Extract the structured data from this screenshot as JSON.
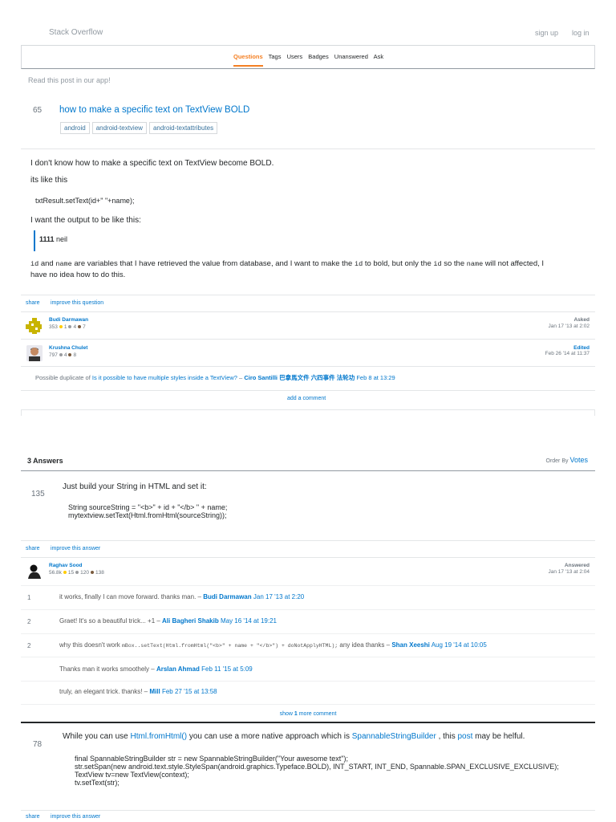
{
  "topbar": {
    "site": "Stack Overflow",
    "signup": "sign up",
    "login": "log in"
  },
  "nav": {
    "items": [
      "Questions",
      "Tags",
      "Users",
      "Badges",
      "Unanswered",
      "Ask"
    ],
    "active": "Questions"
  },
  "app_prompt": "Read this post in our app!",
  "question": {
    "votes": "65",
    "title": "how to make a specific text on TextView BOLD",
    "tags": [
      "android",
      "android-textview",
      "android-textattributes"
    ],
    "body1": "I don't know how to make a specific text on TextView become BOLD.",
    "body2": "its like this",
    "code": "txtResult.setText(id+\" \"+name);",
    "body3": "I want the output to be like this:",
    "quote_bold": "1111",
    "quote_rest": " neil",
    "body4_a": "id",
    "body4_b": " and ",
    "body4_c": "name",
    "body4_d": " are variables that I have retrieved the value from database, and I want to make the ",
    "body4_e": "id",
    "body4_f": " to bold, but only the ",
    "body4_g": "id",
    "body4_h": " so the ",
    "body4_i": "name",
    "body4_j": " will not affected, I",
    "body4_k": "have no idea how to do this.",
    "share": "share",
    "improve": "improve this question",
    "asker": {
      "name": "Budi Darmawan",
      "rep": "353",
      "gold": "1",
      "silver": "4",
      "bronze": "7",
      "action": "Asked",
      "date": "Jan 17 '13 at 2:02"
    },
    "editor": {
      "name": "Krushna Chulet",
      "rep": "797",
      "silver": "4",
      "bronze": "8",
      "action": "Edited",
      "date": "Feb 26 '14 at 11:37"
    },
    "comment": {
      "prefix": "Possible duplicate of ",
      "link": "Is it possible to have multiple styles inside a TextView?",
      "dash": " – ",
      "user": "Ciro Santilli 巴拿馬文件 六四事件 法轮功",
      "date": "Feb 8 at 13:29"
    },
    "add_comment": "add a comment"
  },
  "answers_header": {
    "count": "3 Answers",
    "order_label": "Order By",
    "order_value": "Votes"
  },
  "answer1": {
    "votes": "135",
    "text": "Just build your String in HTML and set it:",
    "code1": "String sourceString = \"<b>\" + id + \"</b> \" + name;",
    "code2": "mytextview.setText(Html.fromHtml(sourceString));",
    "share": "share",
    "improve": "improve this answer",
    "author": {
      "name": "Raghav Sood",
      "rep": "56.8k",
      "gold": "15",
      "silver": "120",
      "bronze": "138",
      "action": "Answered",
      "date": "Jan 17 '13 at 2:04"
    },
    "comments": [
      {
        "score": "1",
        "text": "it works, finally I can move forward. thanks man. – ",
        "user": "Budi Darmawan",
        "date": "Jan 17 '13 at 2:20"
      },
      {
        "score": "2",
        "text": "Graet! It's so a beautiful trick... +1 – ",
        "user": "Ali Bagheri Shakib",
        "date": "May 16 '14 at 19:21"
      },
      {
        "score": "2",
        "text": "why this doesn't work ",
        "code": "mBox..setText(Html.fromHtml(\"<b>\" + name + \"</b>\") + doNotApplyHTML);",
        "text2": " any idea thanks – ",
        "user": "Shan Xeeshi",
        "date": "Aug 19 '14 at 10:05"
      },
      {
        "score": "",
        "text": "Thanks man it works smoothely – ",
        "user": "Arslan Ahmad",
        "date": "Feb 11 '15 at 5:09"
      },
      {
        "score": "",
        "text": "truly, an elegant trick. thanks! – ",
        "user": "Mill",
        "date": "Feb 27 '15 at 13:58"
      }
    ],
    "show_more_a": "show ",
    "show_more_b": "1",
    "show_more_c": " more comment"
  },
  "answer2": {
    "votes": "78",
    "text_a": "While you can use ",
    "link1": "Html.fromHtml()",
    "text_b": " you can use a more native approach which is ",
    "link2": "SpannableStringBuilder",
    "text_c": " , this ",
    "link3": "post",
    "text_d": " may be helful.",
    "code1": "final SpannableStringBuilder str = new SpannableStringBuilder(\"Your awesome text\");",
    "code2": "str.setSpan(new android.text.style.StyleSpan(android.graphics.Typeface.BOLD), INT_START, INT_END, Spannable.SPAN_EXCLUSIVE_EXCLUSIVE);",
    "code3": "TextView tv=new TextView(context);",
    "code4": "tv.setText(str);",
    "share": "share",
    "improve": "improve this answer"
  },
  "colors": {
    "link": "#0077cc",
    "accent": "#f48024",
    "border": "#e4e6e8"
  }
}
